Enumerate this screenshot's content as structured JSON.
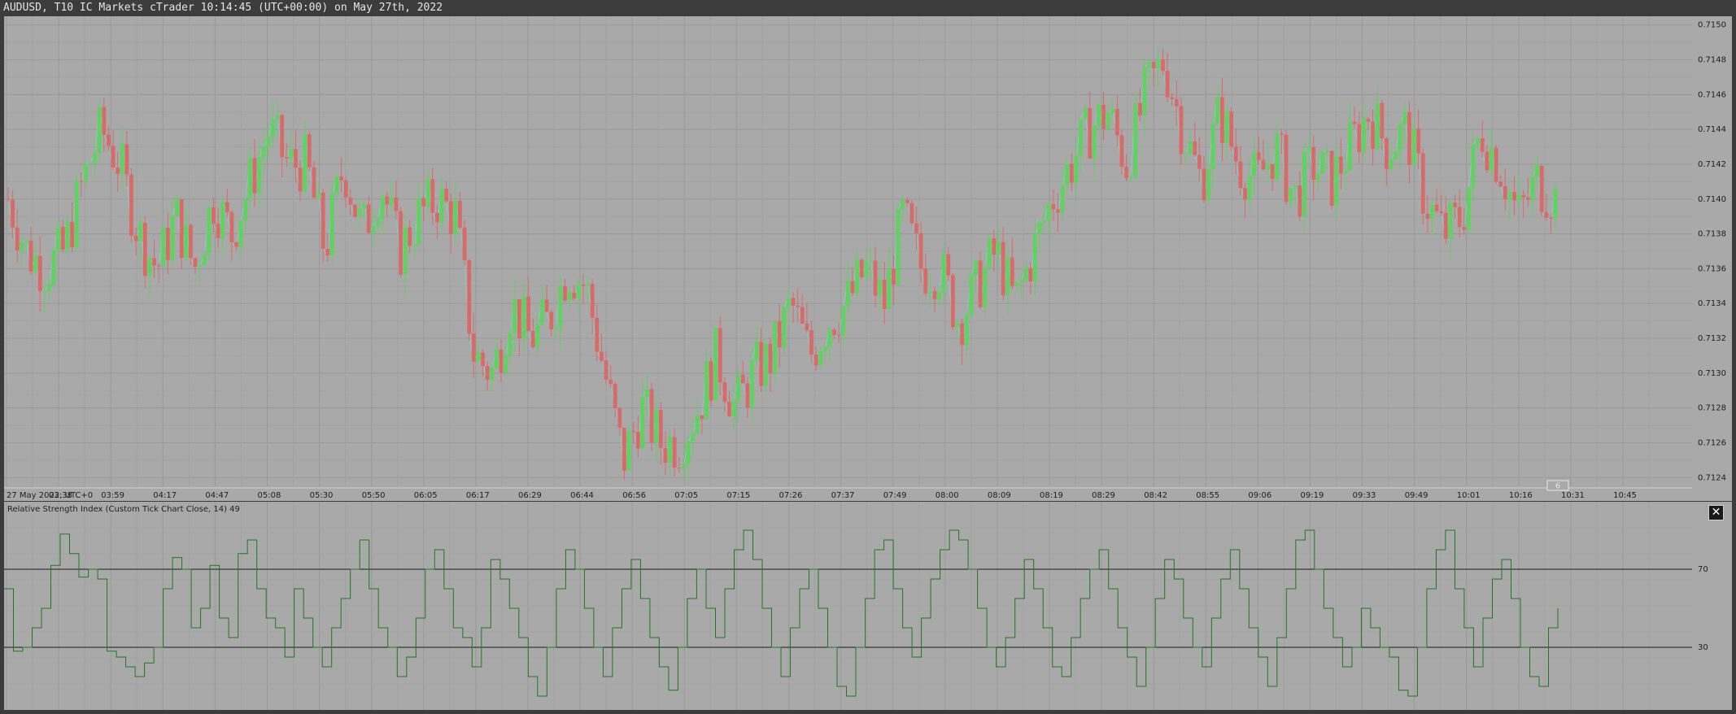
{
  "window": {
    "title": "AUDUSD, T10 IC Markets cTrader 10:14:45 (UTC+00:00) on May 27th, 2022"
  },
  "colors": {
    "chart_background": "#a9a9a9",
    "grid": "#999999",
    "bull_candle": "#5fd35f",
    "bear_candle": "#d96a6a",
    "price_line": "#7fd3c8",
    "rsi_line": "#1e7a1e",
    "level_line": "#1a1a1a",
    "frame": "#3c3c3c"
  },
  "chart_data": [
    {
      "type": "candlestick",
      "symbol": "AUDUSD",
      "timeframe": "T10",
      "y_ticks": [
        "0.7150",
        "0.7148",
        "0.7146",
        "0.7144",
        "0.7142",
        "0.7140",
        "0.7138",
        "0.7136",
        "0.7134",
        "0.7132",
        "0.7130",
        "0.7128",
        "0.7126",
        "0.7124"
      ],
      "ylim": [
        0.71235,
        0.71505
      ],
      "x_labels": [
        "27 May 2022, UTC+0",
        "03:38",
        "03:59",
        "04:17",
        "04:47",
        "05:08",
        "05:30",
        "05:50",
        "06:05",
        "06:17",
        "06:29",
        "06:44",
        "06:56",
        "07:05",
        "07:15",
        "07:26",
        "07:37",
        "07:49",
        "08:00",
        "08:09",
        "08:19",
        "08:29",
        "08:42",
        "08:55",
        "09:06",
        "09:19",
        "09:33",
        "09:49",
        "10:01",
        "10:16",
        "10:31",
        "10:45"
      ],
      "current_marker": "6",
      "close_path": [
        0.714,
        0.7137,
        0.7136,
        0.7137,
        0.7141,
        0.7144,
        0.7142,
        0.7138,
        0.7136,
        0.7139,
        0.7136,
        0.714,
        0.7138,
        0.7141,
        0.7144,
        0.7142,
        0.7142,
        0.7137,
        0.7142,
        0.7138,
        0.7141,
        0.7137,
        0.7139,
        0.714,
        0.7139,
        0.7131,
        0.713,
        0.7134,
        0.7132,
        0.7133,
        0.7136,
        0.7135,
        0.713,
        0.7125,
        0.7128,
        0.7126,
        0.7126,
        0.7128,
        0.7131,
        0.7128,
        0.713,
        0.7131,
        0.7134,
        0.7131,
        0.7133,
        0.7134,
        0.7136,
        0.7134,
        0.7139,
        0.7136,
        0.7136,
        0.7133,
        0.7135,
        0.7137,
        0.7134,
        0.7137,
        0.714,
        0.7142,
        0.7144,
        0.7145,
        0.7142,
        0.7146,
        0.7148,
        0.7144,
        0.7141,
        0.7145,
        0.7142,
        0.7141,
        0.7143,
        0.714,
        0.7142,
        0.7141,
        0.7143,
        0.7145,
        0.7143,
        0.7144,
        0.714,
        0.7138,
        0.7139,
        0.7144,
        0.7142,
        0.7139,
        0.7141,
        0.714
      ],
      "candles_note": "approximate"
    },
    {
      "type": "line",
      "title": "Relative Strength Index (Custom Tick Chart Close, 14) 49",
      "levels": [
        70,
        30
      ],
      "y_ticks": [
        "70",
        "30"
      ],
      "ylim": [
        0,
        100
      ],
      "values": [
        60,
        28,
        30,
        40,
        50,
        72,
        88,
        78,
        66,
        70,
        65,
        28,
        25,
        20,
        15,
        22,
        30,
        60,
        76,
        70,
        40,
        50,
        72,
        45,
        35,
        78,
        85,
        60,
        45,
        40,
        25,
        60,
        45,
        30,
        20,
        40,
        55,
        70,
        85,
        60,
        40,
        30,
        15,
        25,
        45,
        70,
        80,
        60,
        40,
        35,
        20,
        40,
        75,
        65,
        50,
        35,
        15,
        5,
        30,
        60,
        80,
        70,
        50,
        30,
        15,
        40,
        60,
        75,
        55,
        35,
        20,
        8,
        30,
        55,
        70,
        50,
        35,
        60,
        80,
        90,
        75,
        50,
        30,
        15,
        40,
        60,
        70,
        50,
        30,
        10,
        5,
        30,
        55,
        80,
        85,
        60,
        40,
        25,
        45,
        65,
        80,
        90,
        85,
        70,
        50,
        30,
        20,
        35,
        55,
        75,
        60,
        40,
        20,
        15,
        35,
        55,
        70,
        80,
        60,
        40,
        25,
        10,
        30,
        55,
        75,
        65,
        45,
        30,
        20,
        45,
        65,
        80,
        60,
        40,
        25,
        10,
        35,
        60,
        85,
        90,
        70,
        50,
        35,
        20,
        30,
        50,
        40,
        30,
        25,
        8,
        5,
        30,
        60,
        80,
        90,
        60,
        40,
        20,
        45,
        65,
        75,
        55,
        30,
        15,
        10,
        40,
        50
      ]
    }
  ]
}
